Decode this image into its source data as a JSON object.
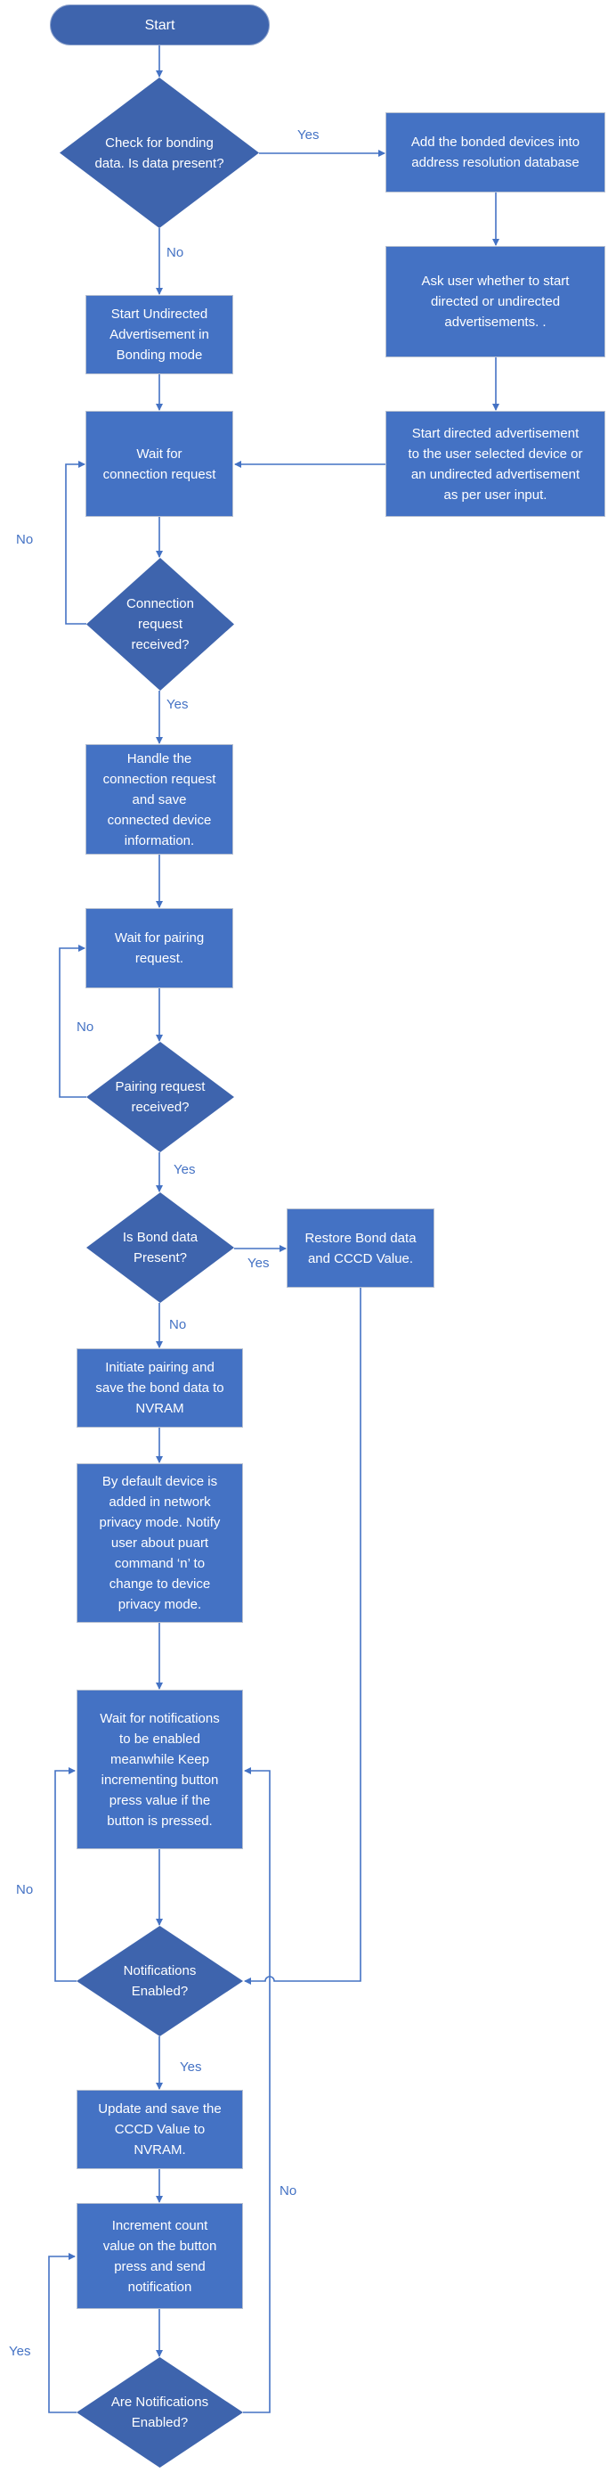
{
  "diagram": {
    "type": "flowchart",
    "colors": {
      "process_fill": "#4472C4",
      "decision_fill": "#3E64AD",
      "connector": "#4472C4",
      "label_text": "#4472C4",
      "node_text": "#FFFFFF"
    },
    "nodes": {
      "start": "Start",
      "check_bonding": "Check for bonding\ndata. Is data present?",
      "add_bonded": "Add the bonded devices into\naddress resolution database",
      "ask_user": "Ask user whether to start\ndirected or undirected\nadvertisements. .",
      "start_undirected": "Start Undirected\nAdvertisement in\nBonding mode",
      "start_directed": "Start directed advertisement\nto the user selected device or\nan undirected advertisement\nas per user input.",
      "wait_connection": "Wait for\nconnection request",
      "connection_received": "Connection\nrequest\nreceived?",
      "handle_connection": "Handle the\nconnection request\nand save\nconnected device\ninformation.",
      "wait_pairing": "Wait for pairing\nrequest.",
      "pairing_received": "Pairing request\nreceived?",
      "bond_present": "Is Bond data\nPresent?",
      "restore_bond": "Restore Bond data\nand CCCD Value.",
      "initiate_pairing": "Initiate pairing and\nsave the bond data to\nNVRAM",
      "default_privacy": "By default device is\nadded in network\nprivacy mode. Notify\nuser about puart\ncommand ‘n’ to\nchange to device\nprivacy mode.",
      "wait_notifications": "Wait for notifications\nto be enabled\nmeanwhile Keep\nincrementing button\npress value if the\nbutton is pressed.",
      "notifications_enabled": "Notifications\nEnabled?",
      "update_cccd": "Update and save the\nCCCD Value to\nNVRAM.",
      "increment_count": "Increment count\nvalue on the button\npress and send\nnotification",
      "are_notifications_enabled": "Are Notifications\nEnabled?"
    },
    "edge_labels": {
      "check_yes": "Yes",
      "check_no": "No",
      "connection_no": "No",
      "connection_yes": "Yes",
      "pairing_no": "No",
      "pairing_yes": "Yes",
      "bond_yes": "Yes",
      "bond_no": "No",
      "notif_no": "No",
      "notif_yes": "Yes",
      "are_notif_no": "No",
      "are_notif_yes": "Yes"
    },
    "edges": [
      {
        "from": "start",
        "to": "check_bonding"
      },
      {
        "from": "check_bonding",
        "to": "add_bonded",
        "label": "Yes"
      },
      {
        "from": "check_bonding",
        "to": "start_undirected",
        "label": "No"
      },
      {
        "from": "add_bonded",
        "to": "ask_user"
      },
      {
        "from": "ask_user",
        "to": "start_directed"
      },
      {
        "from": "start_directed",
        "to": "wait_connection"
      },
      {
        "from": "start_undirected",
        "to": "wait_connection"
      },
      {
        "from": "wait_connection",
        "to": "connection_received"
      },
      {
        "from": "connection_received",
        "to": "wait_connection",
        "label": "No"
      },
      {
        "from": "connection_received",
        "to": "handle_connection",
        "label": "Yes"
      },
      {
        "from": "handle_connection",
        "to": "wait_pairing"
      },
      {
        "from": "wait_pairing",
        "to": "pairing_received"
      },
      {
        "from": "pairing_received",
        "to": "wait_pairing",
        "label": "No"
      },
      {
        "from": "pairing_received",
        "to": "bond_present",
        "label": "Yes"
      },
      {
        "from": "bond_present",
        "to": "restore_bond",
        "label": "Yes"
      },
      {
        "from": "bond_present",
        "to": "initiate_pairing",
        "label": "No"
      },
      {
        "from": "restore_bond",
        "to": "notifications_enabled"
      },
      {
        "from": "initiate_pairing",
        "to": "default_privacy"
      },
      {
        "from": "default_privacy",
        "to": "wait_notifications"
      },
      {
        "from": "wait_notifications",
        "to": "notifications_enabled"
      },
      {
        "from": "notifications_enabled",
        "to": "wait_notifications",
        "label": "No"
      },
      {
        "from": "notifications_enabled",
        "to": "update_cccd",
        "label": "Yes"
      },
      {
        "from": "update_cccd",
        "to": "increment_count"
      },
      {
        "from": "increment_count",
        "to": "are_notifications_enabled"
      },
      {
        "from": "are_notifications_enabled",
        "to": "increment_count",
        "label": "Yes"
      },
      {
        "from": "are_notifications_enabled",
        "to": "wait_notifications",
        "label": "No"
      }
    ]
  }
}
